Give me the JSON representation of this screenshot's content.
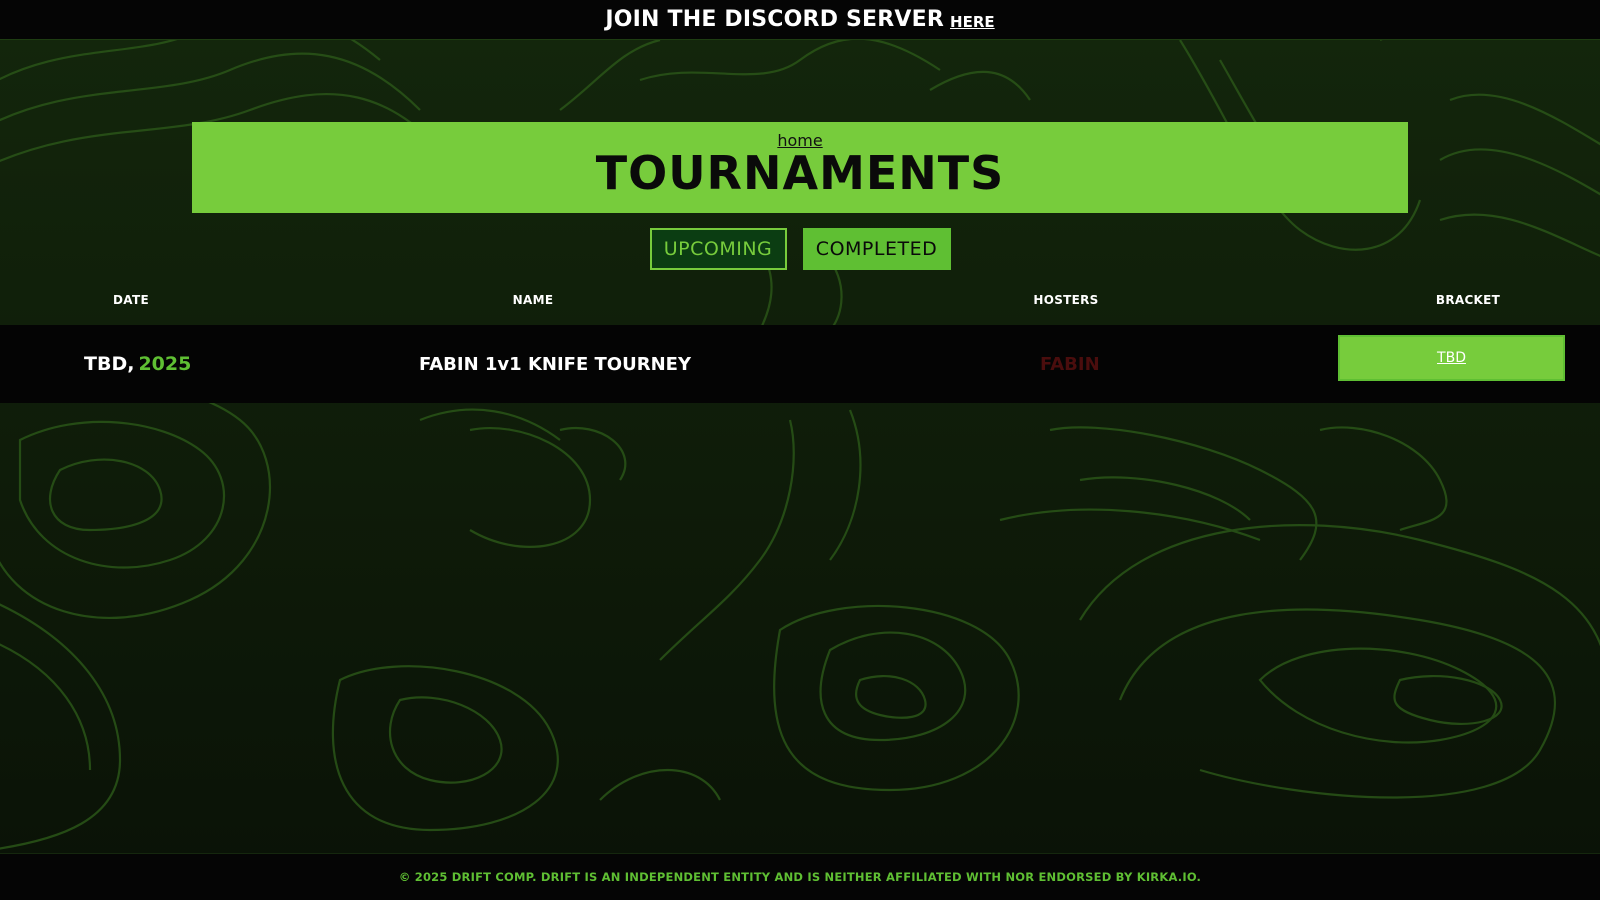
{
  "topbar": {
    "text": "JOIN THE DISCORD SERVER",
    "link_label": "HERE"
  },
  "hero": {
    "home_link": "home",
    "title": "TOURNAMENTS"
  },
  "tabs": [
    {
      "label": "UPCOMING",
      "active": true
    },
    {
      "label": "COMPLETED",
      "active": false
    }
  ],
  "table": {
    "headers": [
      "DATE",
      "NAME",
      "HOSTERS",
      "BRACKET"
    ],
    "rows": [
      {
        "date_prefix": "TBD,",
        "date_year": "2025",
        "name": "FABIN 1v1 KNIFE TOURNEY",
        "hosters": "FABIN",
        "bracket": "TBD"
      }
    ]
  },
  "footer": {
    "text": "© 2025 DRIFT COMP. DRIFT IS AN INDEPENDENT ENTITY AND IS NEITHER AFFILIATED WITH NOR ENDORSED BY KIRKA.IO."
  },
  "colors": {
    "accent": "#77cc3c",
    "accent_dark": "#5fbf33",
    "active_tab_bg": "#0b3d12",
    "background": "#0a0f07",
    "bar": "#050505",
    "hoster_text": "#4a0d0d",
    "topo_line": "#2a5518"
  }
}
